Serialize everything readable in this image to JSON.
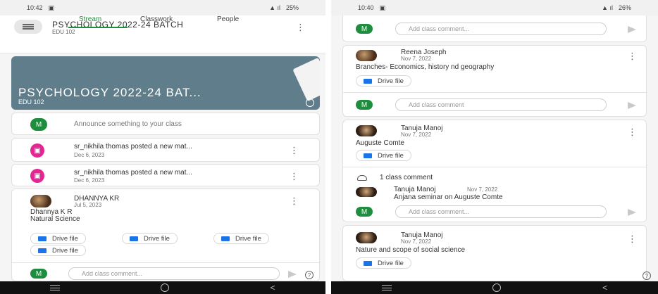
{
  "left": {
    "status": {
      "time": "10:42",
      "battery": "25%"
    },
    "header": {
      "title": "PSYCHOLOGY 2022-24 BATCH",
      "subtitle": "EDU 102",
      "tabs": [
        "Stream",
        "Classwork",
        "People"
      ],
      "active_tab": "Stream"
    },
    "banner": {
      "title": "PSYCHOLOGY 2022-24 BAT...",
      "subtitle": "EDU 102"
    },
    "announce": {
      "avatar": "M",
      "placeholder": "Announce something to your class"
    },
    "posts": [
      {
        "title": "sr_nikhila thomas posted a new mat...",
        "date": "Dec 6, 2023"
      },
      {
        "title": "sr_nikhila thomas posted a new mat...",
        "date": "Dec 6, 2023"
      }
    ],
    "announcement": {
      "author": "DHANNYA KR",
      "date": "Jul 5, 2023",
      "body1": "Dhannya K R",
      "body2": "Natural Science",
      "attachments": [
        "Drive file",
        "Drive file",
        "Drive file",
        "Drive file"
      ],
      "comment_avatar": "M",
      "comment_placeholder": "Add class comment..."
    }
  },
  "right": {
    "status": {
      "time": "10:40",
      "battery": "26%"
    },
    "top_comment": {
      "avatar": "M",
      "placeholder": "Add class comment..."
    },
    "cards": [
      {
        "author": "Reena Joseph",
        "date": "Nov 7, 2022",
        "body": "Branches- Economics, history nd geography",
        "attachment": "Drive file",
        "comment_avatar": "M",
        "comment_placeholder": "Add class comment"
      },
      {
        "author": "Tanuja Manoj",
        "date": "Nov 7, 2022",
        "body": "Auguste Comte",
        "attachment": "Drive file",
        "comments_count": "1 class comment",
        "comment": {
          "author": "Tanuja Manoj",
          "date": "Nov 7, 2022",
          "text": "Anjana seminar on Auguste Comte"
        },
        "comment_avatar": "M",
        "comment_placeholder": "Add class comment..."
      },
      {
        "author": "Tanuja Manoj",
        "date": "Nov 7, 2022",
        "body": "Nature and scope of social science",
        "attachment": "Drive file"
      }
    ]
  },
  "icons": {
    "help": "?",
    "kebab": "⋮",
    "back": "<"
  }
}
